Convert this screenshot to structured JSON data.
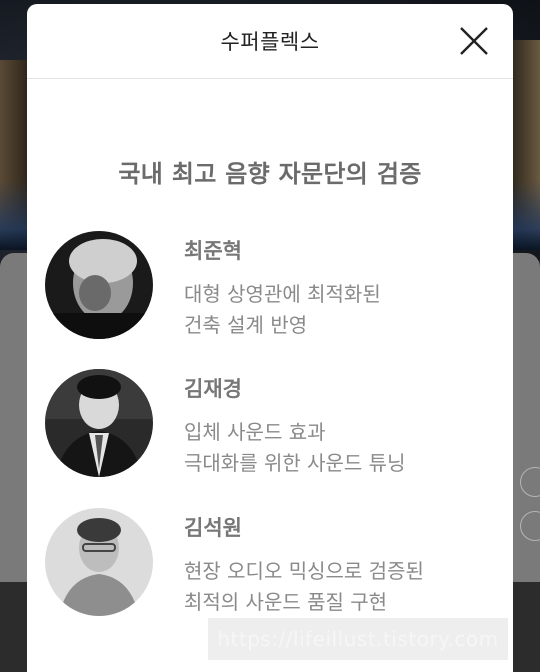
{
  "modal": {
    "title": "수퍼플렉스",
    "section_title": "국내 최고 음향 자문단의 검증"
  },
  "consultants": [
    {
      "name": "최준혁",
      "line1": "대형 상영관에 최적화된",
      "line2": "건축 설계 반영"
    },
    {
      "name": "김재경",
      "line1": "입체 사운드 효과",
      "line2": "극대화를 위한 사운드 튜닝"
    },
    {
      "name": "김석원",
      "line1": "현장 오디오 믹싱으로 검증된",
      "line2": "최적의 사운드 품질 구현"
    }
  ],
  "watermark": "https://lifeillust.tistory.com",
  "icons": {
    "close": "close-icon"
  },
  "colors": {
    "modal_bg": "#ffffff",
    "title": "#222222",
    "name": "#777777",
    "desc": "#8a8a8a"
  }
}
